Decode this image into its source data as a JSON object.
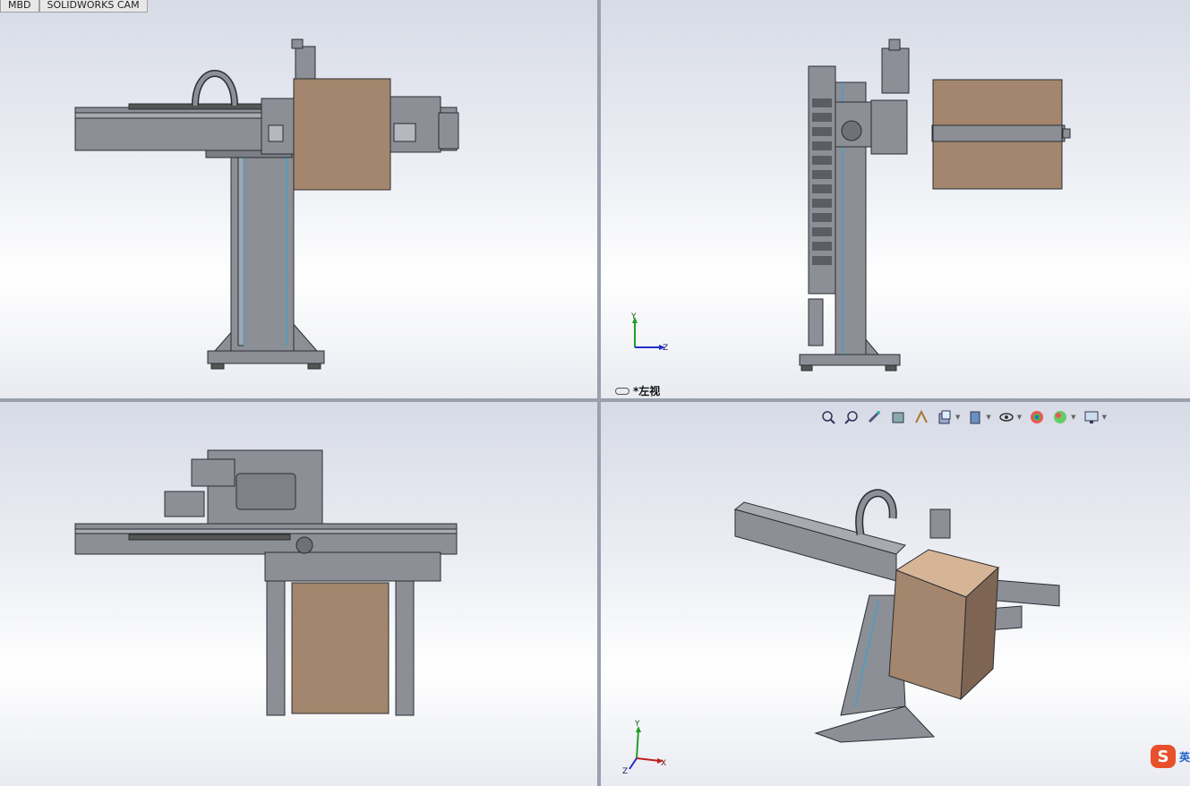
{
  "tabs": [
    "MBD",
    "SOLIDWORKS CAM"
  ],
  "viewports": {
    "top_right": {
      "view_label": "*左视",
      "triad": {
        "y": "Y",
        "z": "Z"
      }
    },
    "bottom_right": {
      "triad": {
        "x": "X",
        "y": "Y",
        "z": "Z"
      }
    }
  },
  "hud_toolbar": [
    "zoom-to-fit",
    "zoom-to-area",
    "previous-view",
    "section-view",
    "dynamic-annotation",
    "view-orientation",
    "display-style",
    "hide-show-items",
    "edit-appearance",
    "apply-scene",
    "view-settings"
  ],
  "ime": {
    "logo": "S",
    "text": "英"
  },
  "colors": {
    "part_fill": "#8c8f96",
    "edge": "#2a2d33",
    "highlight": "#27a5e0",
    "box": "#a3866d",
    "box_light": "#d6b496"
  }
}
